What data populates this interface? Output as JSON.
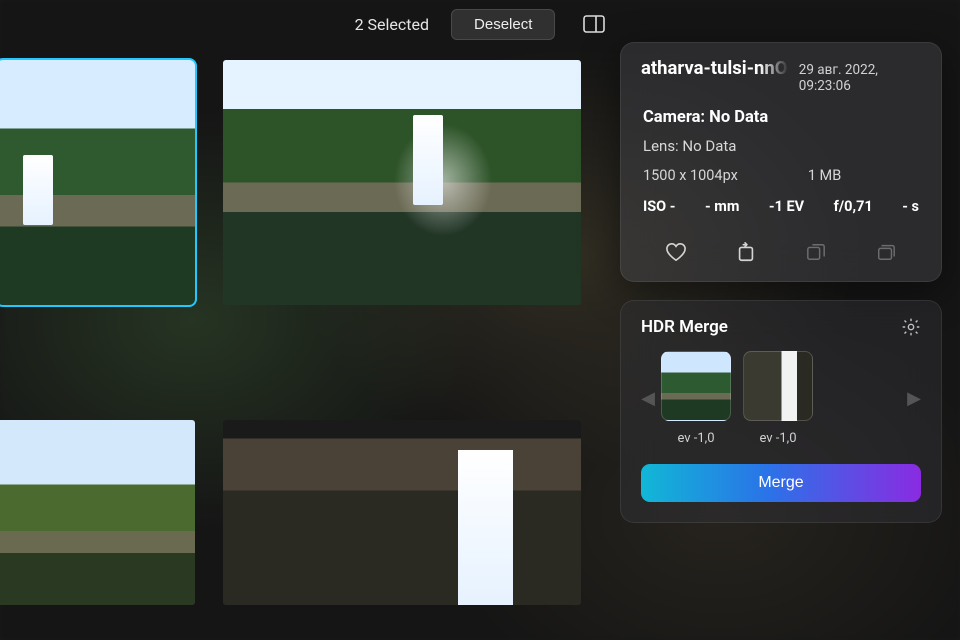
{
  "topbar": {
    "selection_count_label": "2 Selected",
    "deselect_label": "Deselect"
  },
  "info": {
    "filename": "atharva-tulsi-nnOW",
    "timestamp": "29 авг. 2022, 09:23:06",
    "camera_label": "Camera: No Data",
    "lens_label": "Lens: No Data",
    "dimensions": "1500 x 1004px",
    "filesize": "1 MB",
    "exif": {
      "iso": "ISO -",
      "focal": "- mm",
      "ev": "-1 EV",
      "aperture": "f/0,71",
      "shutter": "- s"
    }
  },
  "hdr": {
    "title": "HDR Merge",
    "thumbs": [
      {
        "ev": "ev -1,0"
      },
      {
        "ev": "ev -1,0"
      }
    ],
    "merge_label": "Merge"
  }
}
